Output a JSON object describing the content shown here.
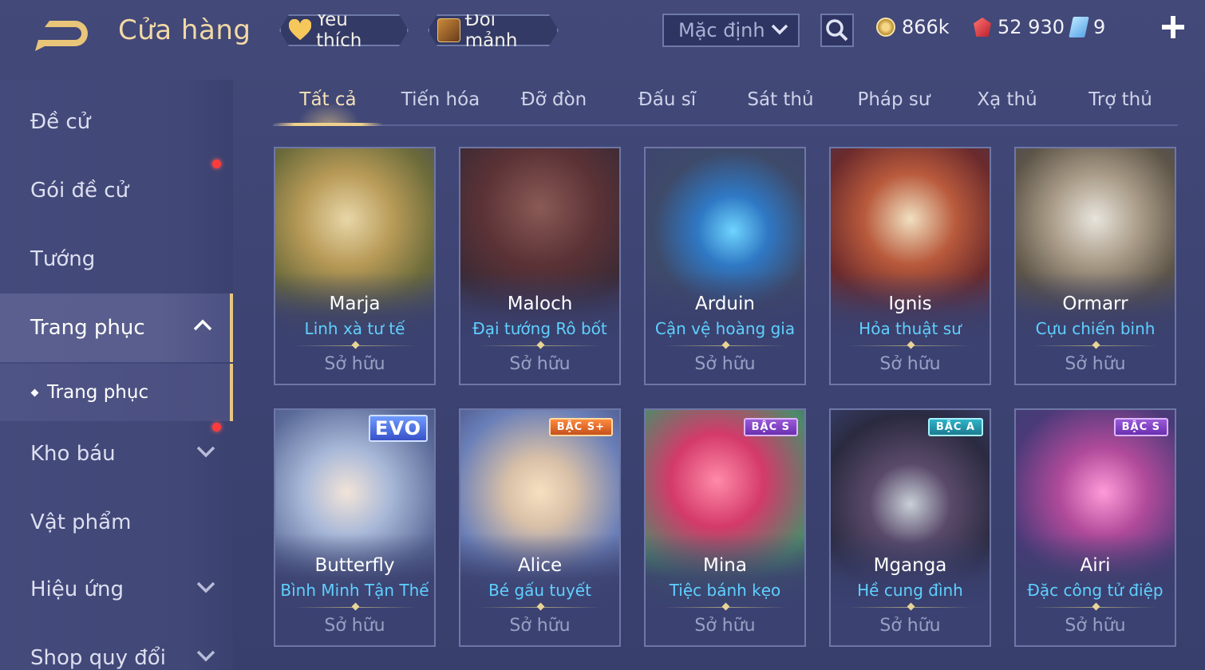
{
  "header": {
    "title": "Cửa hàng",
    "favorite_label": "Yêu thích",
    "trade_label": "Đổi mảnh",
    "sort_value": "Mặc định",
    "currencies": {
      "gold": "866k",
      "ruby": "52 930",
      "voucher": "9"
    }
  },
  "sidebar": {
    "items": [
      {
        "label": "Đề cử"
      },
      {
        "label": "Gói đề cử"
      },
      {
        "label": "Tướng"
      },
      {
        "label": "Trang phục"
      },
      {
        "label": "Trang phục"
      },
      {
        "label": "Kho báu"
      },
      {
        "label": "Vật phẩm"
      },
      {
        "label": "Hiệu ứng"
      },
      {
        "label": "Shop quy đổi"
      }
    ]
  },
  "tabs": [
    "Tất cả",
    "Tiến hóa",
    "Đỡ đòn",
    "Đấu sĩ",
    "Sát thủ",
    "Pháp sư",
    "Xạ thủ",
    "Trợ thủ"
  ],
  "cards": [
    {
      "hero": "Marja",
      "skin": "Linh xà tư tế",
      "status": "Sở hữu",
      "badge": ""
    },
    {
      "hero": "Maloch",
      "skin": "Đại tướng Rô bốt",
      "status": "Sở hữu",
      "badge": ""
    },
    {
      "hero": "Arduin",
      "skin": "Cận vệ hoàng gia",
      "status": "Sở hữu",
      "badge": ""
    },
    {
      "hero": "Ignis",
      "skin": "Hỏa thuật sư",
      "status": "Sở hữu",
      "badge": ""
    },
    {
      "hero": "Ormarr",
      "skin": "Cựu chiến binh",
      "status": "Sở hữu",
      "badge": ""
    },
    {
      "hero": "Butterfly",
      "skin": "Bình Minh Tận Thế",
      "status": "Sở hữu",
      "badge": "EVO"
    },
    {
      "hero": "Alice",
      "skin": "Bé gấu tuyết",
      "status": "Sở hữu",
      "badge": "BẬC S+"
    },
    {
      "hero": "Mina",
      "skin": "Tiệc bánh kẹo",
      "status": "Sở hữu",
      "badge": "BẬC S"
    },
    {
      "hero": "Mganga",
      "skin": "Hề cung đình",
      "status": "Sở hữu",
      "badge": "BẬC A"
    },
    {
      "hero": "Airi",
      "skin": "Đặc công tử điệp",
      "status": "Sở hữu",
      "badge": "BẬC S"
    }
  ],
  "colors": {
    "accent_gold": "#f0d08d",
    "skin_name": "#5fd0ff",
    "notification": "#ff3b3b"
  }
}
